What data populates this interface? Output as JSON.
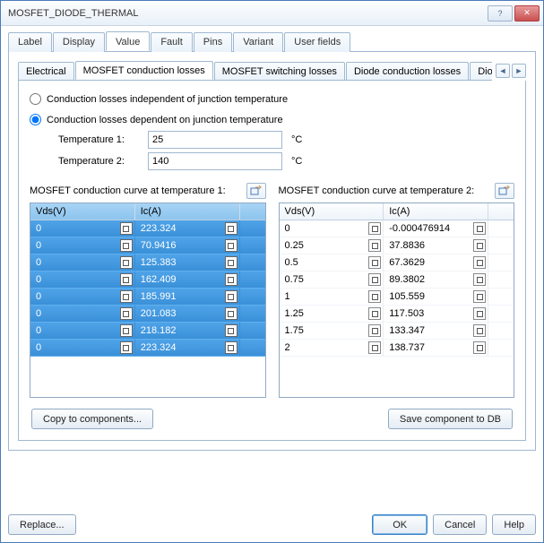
{
  "window": {
    "title": "MOSFET_DIODE_THERMAL"
  },
  "outer_tabs": [
    "Label",
    "Display",
    "Value",
    "Fault",
    "Pins",
    "Variant",
    "User fields"
  ],
  "outer_active": 2,
  "inner_tabs": [
    "Electrical",
    "MOSFET conduction losses",
    "MOSFET switching losses",
    "Diode conduction losses",
    "Diode switchi"
  ],
  "inner_active": 1,
  "radio": {
    "independent": "Conduction losses independent of junction temperature",
    "dependent": "Conduction losses dependent on junction temperature",
    "selected": "dependent"
  },
  "temps": {
    "t1_label": "Temperature 1:",
    "t1_value": "25",
    "t2_label": "Temperature 2:",
    "t2_value": "140",
    "unit": "°C"
  },
  "curves": {
    "left": {
      "title": "MOSFET conduction curve at temperature 1:",
      "col1": "Vds(V)",
      "col2": "Ic(A)",
      "rows": [
        {
          "v": "0",
          "i": "223.324"
        },
        {
          "v": "0",
          "i": "70.9416"
        },
        {
          "v": "0",
          "i": "125.383"
        },
        {
          "v": "0",
          "i": "162.409"
        },
        {
          "v": "0",
          "i": "185.991"
        },
        {
          "v": "0",
          "i": "201.083"
        },
        {
          "v": "0",
          "i": "218.182"
        },
        {
          "v": "0",
          "i": "223.324"
        }
      ],
      "selected": true
    },
    "right": {
      "title": "MOSFET conduction curve at temperature 2:",
      "col1": "Vds(V)",
      "col2": "Ic(A)",
      "rows": [
        {
          "v": "0",
          "i": "-0.000476914"
        },
        {
          "v": "0.25",
          "i": "37.8836"
        },
        {
          "v": "0.5",
          "i": "67.3629"
        },
        {
          "v": "0.75",
          "i": "89.3802"
        },
        {
          "v": "1",
          "i": "105.559"
        },
        {
          "v": "1.25",
          "i": "117.503"
        },
        {
          "v": "1.75",
          "i": "133.347"
        },
        {
          "v": "2",
          "i": "138.737"
        }
      ],
      "selected": false
    }
  },
  "buttons": {
    "copy": "Copy to components...",
    "savedb": "Save component to DB",
    "replace": "Replace...",
    "ok": "OK",
    "cancel": "Cancel",
    "help": "Help"
  }
}
